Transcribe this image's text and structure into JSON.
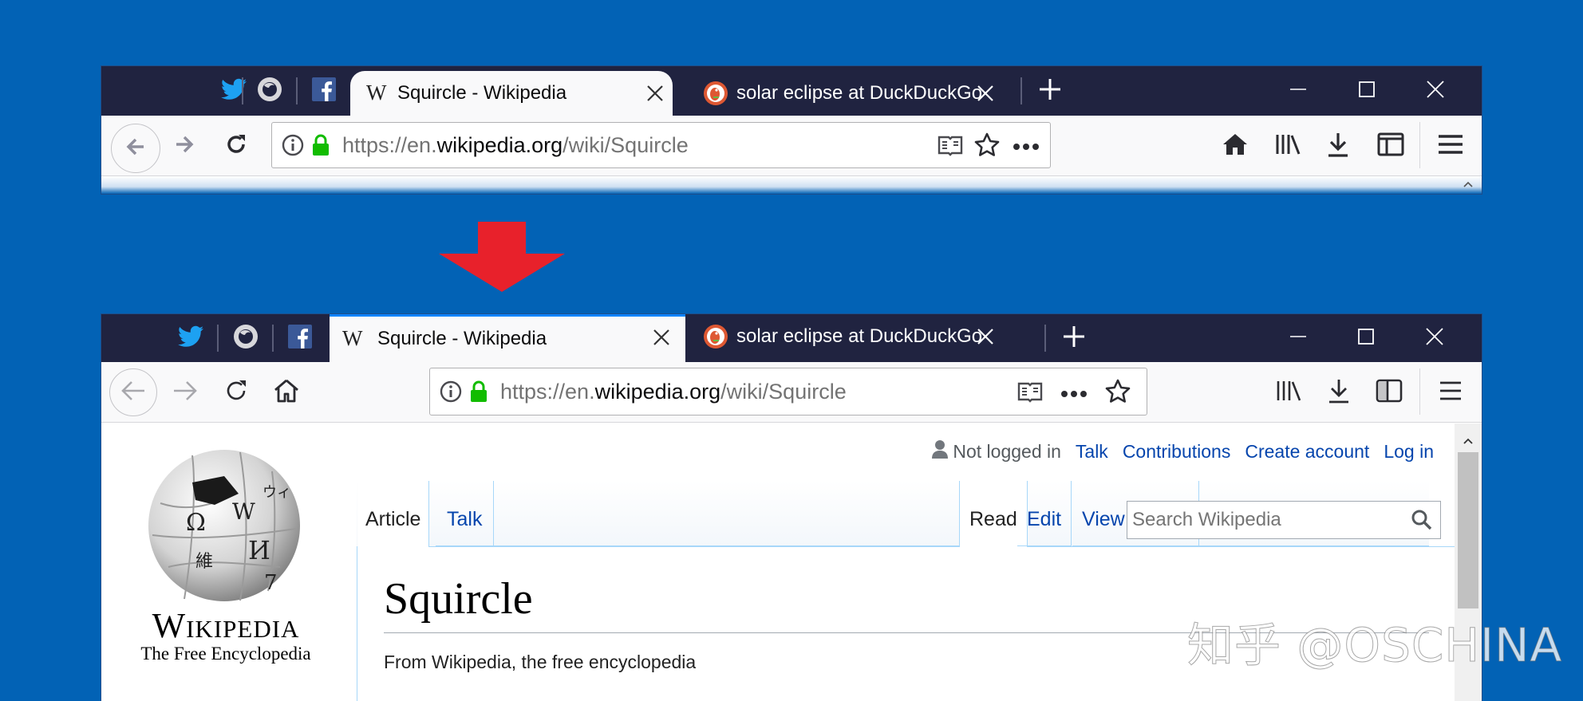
{
  "colors": {
    "background": "#0262b5",
    "tab_strip": "#202340",
    "lock_green": "#12bc00",
    "arrow_red": "#e8212b",
    "wiki_link": "#0645ad"
  },
  "tabs": {
    "pinned": [
      "twitter-icon",
      "firefox-icon",
      "facebook-icon"
    ],
    "active": {
      "icon": "wikipedia-w-icon",
      "title": "Squircle - Wikipedia"
    },
    "other": {
      "icon": "duckduckgo-icon",
      "title": "solar eclipse at DuckDuckGo"
    },
    "new_tab": "plus-icon"
  },
  "url": {
    "scheme": "https://en.",
    "host": "wikipedia.org",
    "path": "/wiki/Squircle"
  },
  "wiki": {
    "wordmark": "Wikipedia",
    "tagline": "The Free Encyclopedia",
    "personal": [
      "Not logged in",
      "Talk",
      "Contributions",
      "Create account",
      "Log in"
    ],
    "left_tabs": [
      "Article",
      "Talk"
    ],
    "right_tabs": [
      "Read",
      "Edit",
      "View history"
    ],
    "search_placeholder": "Search Wikipedia",
    "heading": "Squircle",
    "tagline_body": "From Wikipedia, the free encyclopedia"
  },
  "watermark": "知乎 @OSCHINA"
}
